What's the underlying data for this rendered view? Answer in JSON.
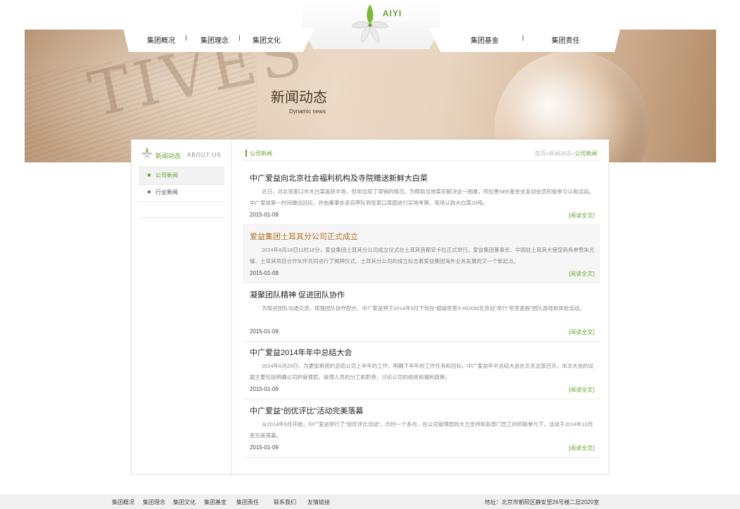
{
  "brand": {
    "name": "AIYI",
    "accent_color": "#6aa431",
    "highlight_title_color": "#b0702a"
  },
  "nav": {
    "items": [
      {
        "label": "集团概况"
      },
      {
        "label": "集团理念"
      },
      {
        "label": "集团文化"
      },
      {
        "label": "集团基金"
      },
      {
        "label": "集团责任"
      }
    ]
  },
  "banner": {
    "title": "新闻动态",
    "subtitle": "Dynamic news",
    "watermark": "TIVES"
  },
  "sidebar": {
    "heading_cn": "新闻动态",
    "heading_en": "ABOUT US",
    "items": [
      {
        "label": "公司新闻",
        "active": true
      },
      {
        "label": "行业新闻",
        "active": false
      }
    ]
  },
  "main": {
    "section_title": "公司新闻",
    "breadcrumb": {
      "home": "首页",
      "sep": "»",
      "parent": "新闻动态",
      "current": "公司新闻"
    },
    "read_more": "[阅读全文]",
    "articles": [
      {
        "title": "中广爱益向北京社会福利机构及寺院赠送新鲜大白菜",
        "summary": "近日，河北张家口市大白菜喜获丰收，但却出现了滞销的情况。为帮助当地菜农解决这一困难，阿拉善SEE基金会发动会员积极参与认购活动。中广爱益第一时间做出回应，并由董事长亲自带队到张家口菜园进行实地考察，现场认购大白菜10吨。",
        "date": "2015-01-09"
      },
      {
        "title": "爱益集团土耳其分公司正式成立",
        "summary": "2014年8月18日11时18分，爱益集团土耳其分公司成立仪式在土耳其首都安卡拉正式举行。爱益集团董事长、中国驻土耳其大使馆商务参赞朱光耀、土耳其项目合作伙伴共同进行了揭牌仪式。土耳其分公司的成立标志着爱益集团海外业务发展的又一个新起点。",
        "date": "2015-01-09"
      },
      {
        "title": "凝聚团队精神 促进团队协作",
        "summary": "为增进团队沟通交流，增强团队协作配合，中广爱益将于2014年9月下旬在“超级密室X-ROOM北京站”举行“密室逃脱”团队游戏和体验活动。",
        "date": "2015-01-09"
      },
      {
        "title": "中广爱益2014年年中总结大会",
        "summary": "2014年6月29日，为更加系统的总结公司上半年的工作，明确下半年的工作任务和目标，中广爱益年中总结大会在北京总部召开。本次大会的议题主要包括明确公司的管理层，管理人员的分工和职责；讨论公司的绩效和福利政策；",
        "date": "2015-01-09"
      },
      {
        "title": "中广爱益“创优评比”活动完美落幕",
        "summary": "从2014年9月开始，中广爱益举行了“创优评比活动”，历时一个多月，在公司管理层的大力支持和各部门员工的积极参与下，活动于2014年10月底完美落幕。",
        "date": "2015-01-09"
      }
    ]
  },
  "footer": {
    "links": [
      "集团概况",
      "集团理念",
      "集团文化",
      "集团基金",
      "集团责任",
      "联系我们",
      "友情链接"
    ],
    "address": "地址：北京市朝阳区静安里26号楼二层2020室"
  }
}
